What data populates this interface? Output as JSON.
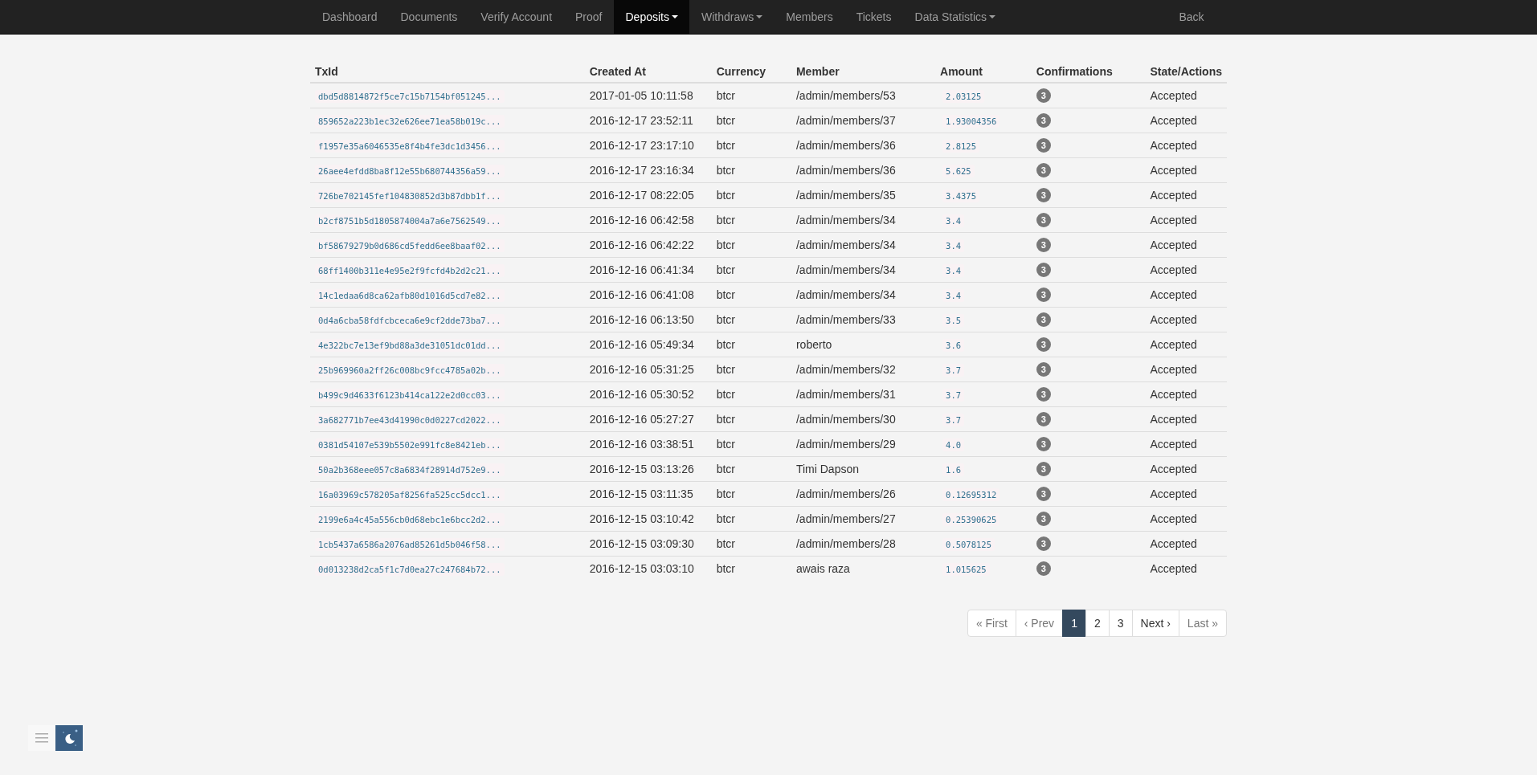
{
  "navbar": {
    "items": [
      {
        "label": "Dashboard",
        "selected": false,
        "dropdown": false
      },
      {
        "label": "Documents",
        "selected": false,
        "dropdown": false
      },
      {
        "label": "Verify Account",
        "selected": false,
        "dropdown": false
      },
      {
        "label": "Proof",
        "selected": false,
        "dropdown": false
      },
      {
        "label": "Deposits",
        "selected": true,
        "dropdown": true
      },
      {
        "label": "Withdraws",
        "selected": false,
        "dropdown": true
      },
      {
        "label": "Members",
        "selected": false,
        "dropdown": false
      },
      {
        "label": "Tickets",
        "selected": false,
        "dropdown": false
      },
      {
        "label": "Data Statistics",
        "selected": false,
        "dropdown": true
      }
    ],
    "right_link": "Back"
  },
  "table": {
    "columns": [
      "TxId",
      "Created At",
      "Currency",
      "Member",
      "Amount",
      "Confirmations",
      "State/Actions"
    ],
    "rows": [
      {
        "txid": "dbd5d8814872f5ce7c15b7154bf051245...",
        "created_at": "2017-01-05 10:11:58",
        "currency": "btcr",
        "member": "/admin/members/53",
        "amount": "2.03125",
        "confirmations": "3",
        "state": "Accepted"
      },
      {
        "txid": "859652a223b1ec32e626ee71ea58b019c...",
        "created_at": "2016-12-17 23:52:11",
        "currency": "btcr",
        "member": "/admin/members/37",
        "amount": "1.93004356",
        "confirmations": "3",
        "state": "Accepted"
      },
      {
        "txid": "f1957e35a6046535e8f4b4fe3dc1d3456...",
        "created_at": "2016-12-17 23:17:10",
        "currency": "btcr",
        "member": "/admin/members/36",
        "amount": "2.8125",
        "confirmations": "3",
        "state": "Accepted"
      },
      {
        "txid": "26aee4efdd8ba8f12e55b680744356a59...",
        "created_at": "2016-12-17 23:16:34",
        "currency": "btcr",
        "member": "/admin/members/36",
        "amount": "5.625",
        "confirmations": "3",
        "state": "Accepted"
      },
      {
        "txid": "726be702145fef104830852d3b87dbb1f...",
        "created_at": "2016-12-17 08:22:05",
        "currency": "btcr",
        "member": "/admin/members/35",
        "amount": "3.4375",
        "confirmations": "3",
        "state": "Accepted"
      },
      {
        "txid": "b2cf8751b5d1805874004a7a6e7562549...",
        "created_at": "2016-12-16 06:42:58",
        "currency": "btcr",
        "member": "/admin/members/34",
        "amount": "3.4",
        "confirmations": "3",
        "state": "Accepted"
      },
      {
        "txid": "bf58679279b0d686cd5fedd6ee8baaf02...",
        "created_at": "2016-12-16 06:42:22",
        "currency": "btcr",
        "member": "/admin/members/34",
        "amount": "3.4",
        "confirmations": "3",
        "state": "Accepted"
      },
      {
        "txid": "68ff1400b311e4e95e2f9fcfd4b2d2c21...",
        "created_at": "2016-12-16 06:41:34",
        "currency": "btcr",
        "member": "/admin/members/34",
        "amount": "3.4",
        "confirmations": "3",
        "state": "Accepted"
      },
      {
        "txid": "14c1edaa6d8ca62afb80d1016d5cd7e82...",
        "created_at": "2016-12-16 06:41:08",
        "currency": "btcr",
        "member": "/admin/members/34",
        "amount": "3.4",
        "confirmations": "3",
        "state": "Accepted"
      },
      {
        "txid": "0d4a6cba58fdfcbceca6e9cf2dde73ba7...",
        "created_at": "2016-12-16 06:13:50",
        "currency": "btcr",
        "member": "/admin/members/33",
        "amount": "3.5",
        "confirmations": "3",
        "state": "Accepted"
      },
      {
        "txid": "4e322bc7e13ef9bd88a3de31051dc01dd...",
        "created_at": "2016-12-16 05:49:34",
        "currency": "btcr",
        "member": "roberto",
        "amount": "3.6",
        "confirmations": "3",
        "state": "Accepted"
      },
      {
        "txid": "25b969960a2ff26c008bc9fcc4785a02b...",
        "created_at": "2016-12-16 05:31:25",
        "currency": "btcr",
        "member": "/admin/members/32",
        "amount": "3.7",
        "confirmations": "3",
        "state": "Accepted"
      },
      {
        "txid": "b499c9d4633f6123b414ca122e2d0cc03...",
        "created_at": "2016-12-16 05:30:52",
        "currency": "btcr",
        "member": "/admin/members/31",
        "amount": "3.7",
        "confirmations": "3",
        "state": "Accepted"
      },
      {
        "txid": "3a682771b7ee43d41990c0d0227cd2022...",
        "created_at": "2016-12-16 05:27:27",
        "currency": "btcr",
        "member": "/admin/members/30",
        "amount": "3.7",
        "confirmations": "3",
        "state": "Accepted"
      },
      {
        "txid": "0381d54107e539b5502e991fc8e8421eb...",
        "created_at": "2016-12-16 03:38:51",
        "currency": "btcr",
        "member": "/admin/members/29",
        "amount": "4.0",
        "confirmations": "3",
        "state": "Accepted"
      },
      {
        "txid": "50a2b368eee057c8a6834f28914d752e9...",
        "created_at": "2016-12-15 03:13:26",
        "currency": "btcr",
        "member": "Timi Dapson",
        "amount": "1.6",
        "confirmations": "3",
        "state": "Accepted"
      },
      {
        "txid": "16a03969c578205af8256fa525cc5dcc1...",
        "created_at": "2016-12-15 03:11:35",
        "currency": "btcr",
        "member": "/admin/members/26",
        "amount": "0.12695312",
        "confirmations": "3",
        "state": "Accepted"
      },
      {
        "txid": "2199e6a4c45a556cb0d68ebc1e6bcc2d2...",
        "created_at": "2016-12-15 03:10:42",
        "currency": "btcr",
        "member": "/admin/members/27",
        "amount": "0.25390625",
        "confirmations": "3",
        "state": "Accepted"
      },
      {
        "txid": "1cb5437a6586a2076ad85261d5b046f58...",
        "created_at": "2016-12-15 03:09:30",
        "currency": "btcr",
        "member": "/admin/members/28",
        "amount": "0.5078125",
        "confirmations": "3",
        "state": "Accepted"
      },
      {
        "txid": "0d013238d2ca5f1c7d0ea27c247684b72...",
        "created_at": "2016-12-15 03:03:10",
        "currency": "btcr",
        "member": "awais raza",
        "amount": "1.015625",
        "confirmations": "3",
        "state": "Accepted"
      }
    ]
  },
  "pagination": [
    {
      "label": "« First",
      "selected": false,
      "disabled": true
    },
    {
      "label": "‹ Prev",
      "selected": false,
      "disabled": true
    },
    {
      "label": "1",
      "selected": true,
      "disabled": false
    },
    {
      "label": "2",
      "selected": false,
      "disabled": false
    },
    {
      "label": "3",
      "selected": false,
      "disabled": false
    },
    {
      "label": "Next ›",
      "selected": false,
      "disabled": false
    },
    {
      "label": "Last »",
      "selected": false,
      "disabled": true
    }
  ],
  "corner_tools": [
    {
      "kind": "menu",
      "selected": false
    },
    {
      "kind": "night",
      "selected": true
    }
  ]
}
